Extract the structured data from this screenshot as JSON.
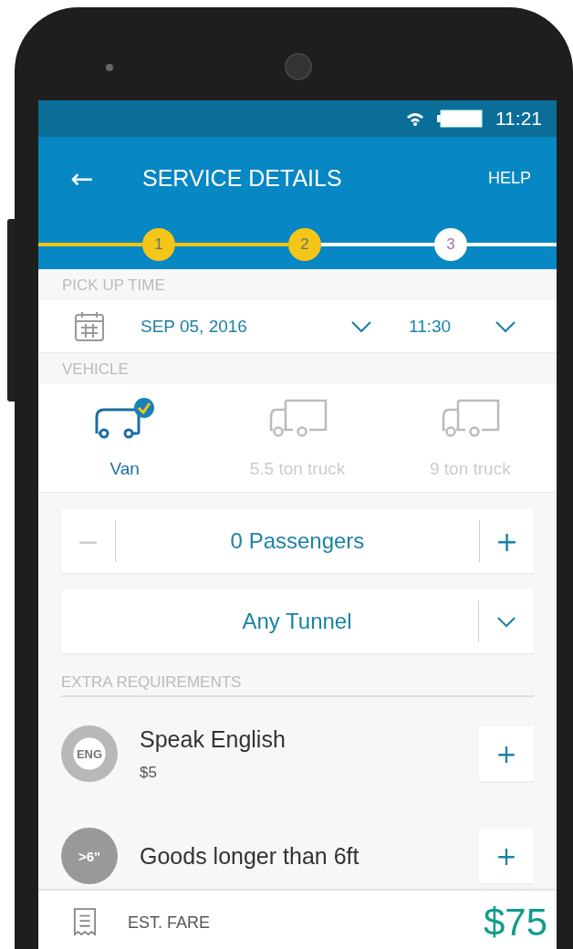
{
  "status_bar": {
    "time": "11:21"
  },
  "app_bar": {
    "back": "←",
    "title": "SERVICE DETAILS",
    "help": "HELP"
  },
  "steps": [
    {
      "label": "1",
      "done": true
    },
    {
      "label": "2",
      "done": true
    },
    {
      "label": "3",
      "done": false
    }
  ],
  "pickup": {
    "label": "PICK UP TIME",
    "date": "SEP 05, 2016",
    "time": "11:30"
  },
  "vehicle": {
    "label": "VEHICLE",
    "options": [
      {
        "name": "Van",
        "kind": "van",
        "selected": true
      },
      {
        "name": "5.5 ton truck",
        "kind": "truck",
        "selected": false
      },
      {
        "name": "9 ton truck",
        "kind": "truck",
        "selected": false
      }
    ]
  },
  "passengers": {
    "minus": "−",
    "value": "0 Passengers",
    "plus": "+",
    "minus_disabled": true
  },
  "tunnel": {
    "value": "Any Tunnel"
  },
  "extra": {
    "label": "EXTRA REQUIREMENTS",
    "items": [
      {
        "badge": "ENG",
        "kind": "language",
        "title": "Speak English",
        "price": "$5",
        "add": "+"
      },
      {
        "badge": ">6\"",
        "kind": "length",
        "title": "Goods longer than 6ft",
        "add": "+"
      }
    ]
  },
  "fare": {
    "label": "EST. FARE",
    "amount": "$75"
  }
}
